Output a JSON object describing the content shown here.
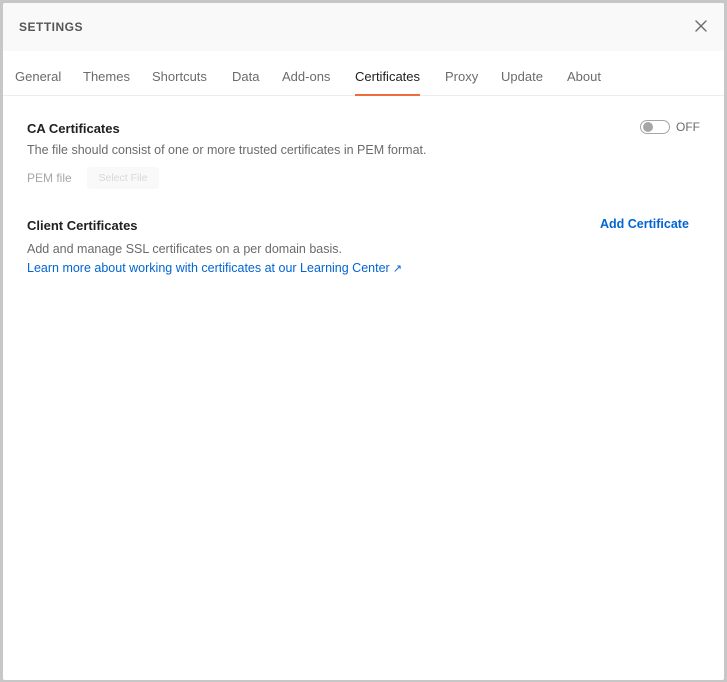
{
  "dialog": {
    "title": "SETTINGS",
    "close_icon": "close-icon"
  },
  "tabs": [
    {
      "label": "General"
    },
    {
      "label": "Themes"
    },
    {
      "label": "Shortcuts"
    },
    {
      "label": "Data"
    },
    {
      "label": "Add-ons"
    },
    {
      "label": "Certificates",
      "active": true
    },
    {
      "label": "Proxy"
    },
    {
      "label": "Update"
    },
    {
      "label": "About"
    }
  ],
  "ca_certificates": {
    "title": "CA Certificates",
    "description": "The file should consist of one or more trusted certificates in PEM format.",
    "toggle_state": "OFF",
    "pem_label": "PEM file",
    "select_file_label": "Select File"
  },
  "client_certificates": {
    "title": "Client Certificates",
    "add_button_label": "Add Certificate",
    "description": "Add and manage SSL certificates on a per domain basis.",
    "learn_more_link": "Learn more about working with certificates at our Learning Center",
    "link_icon": "external-link-icon"
  },
  "colors": {
    "accent_tab": "#f26b3a",
    "link": "#0265d2"
  }
}
